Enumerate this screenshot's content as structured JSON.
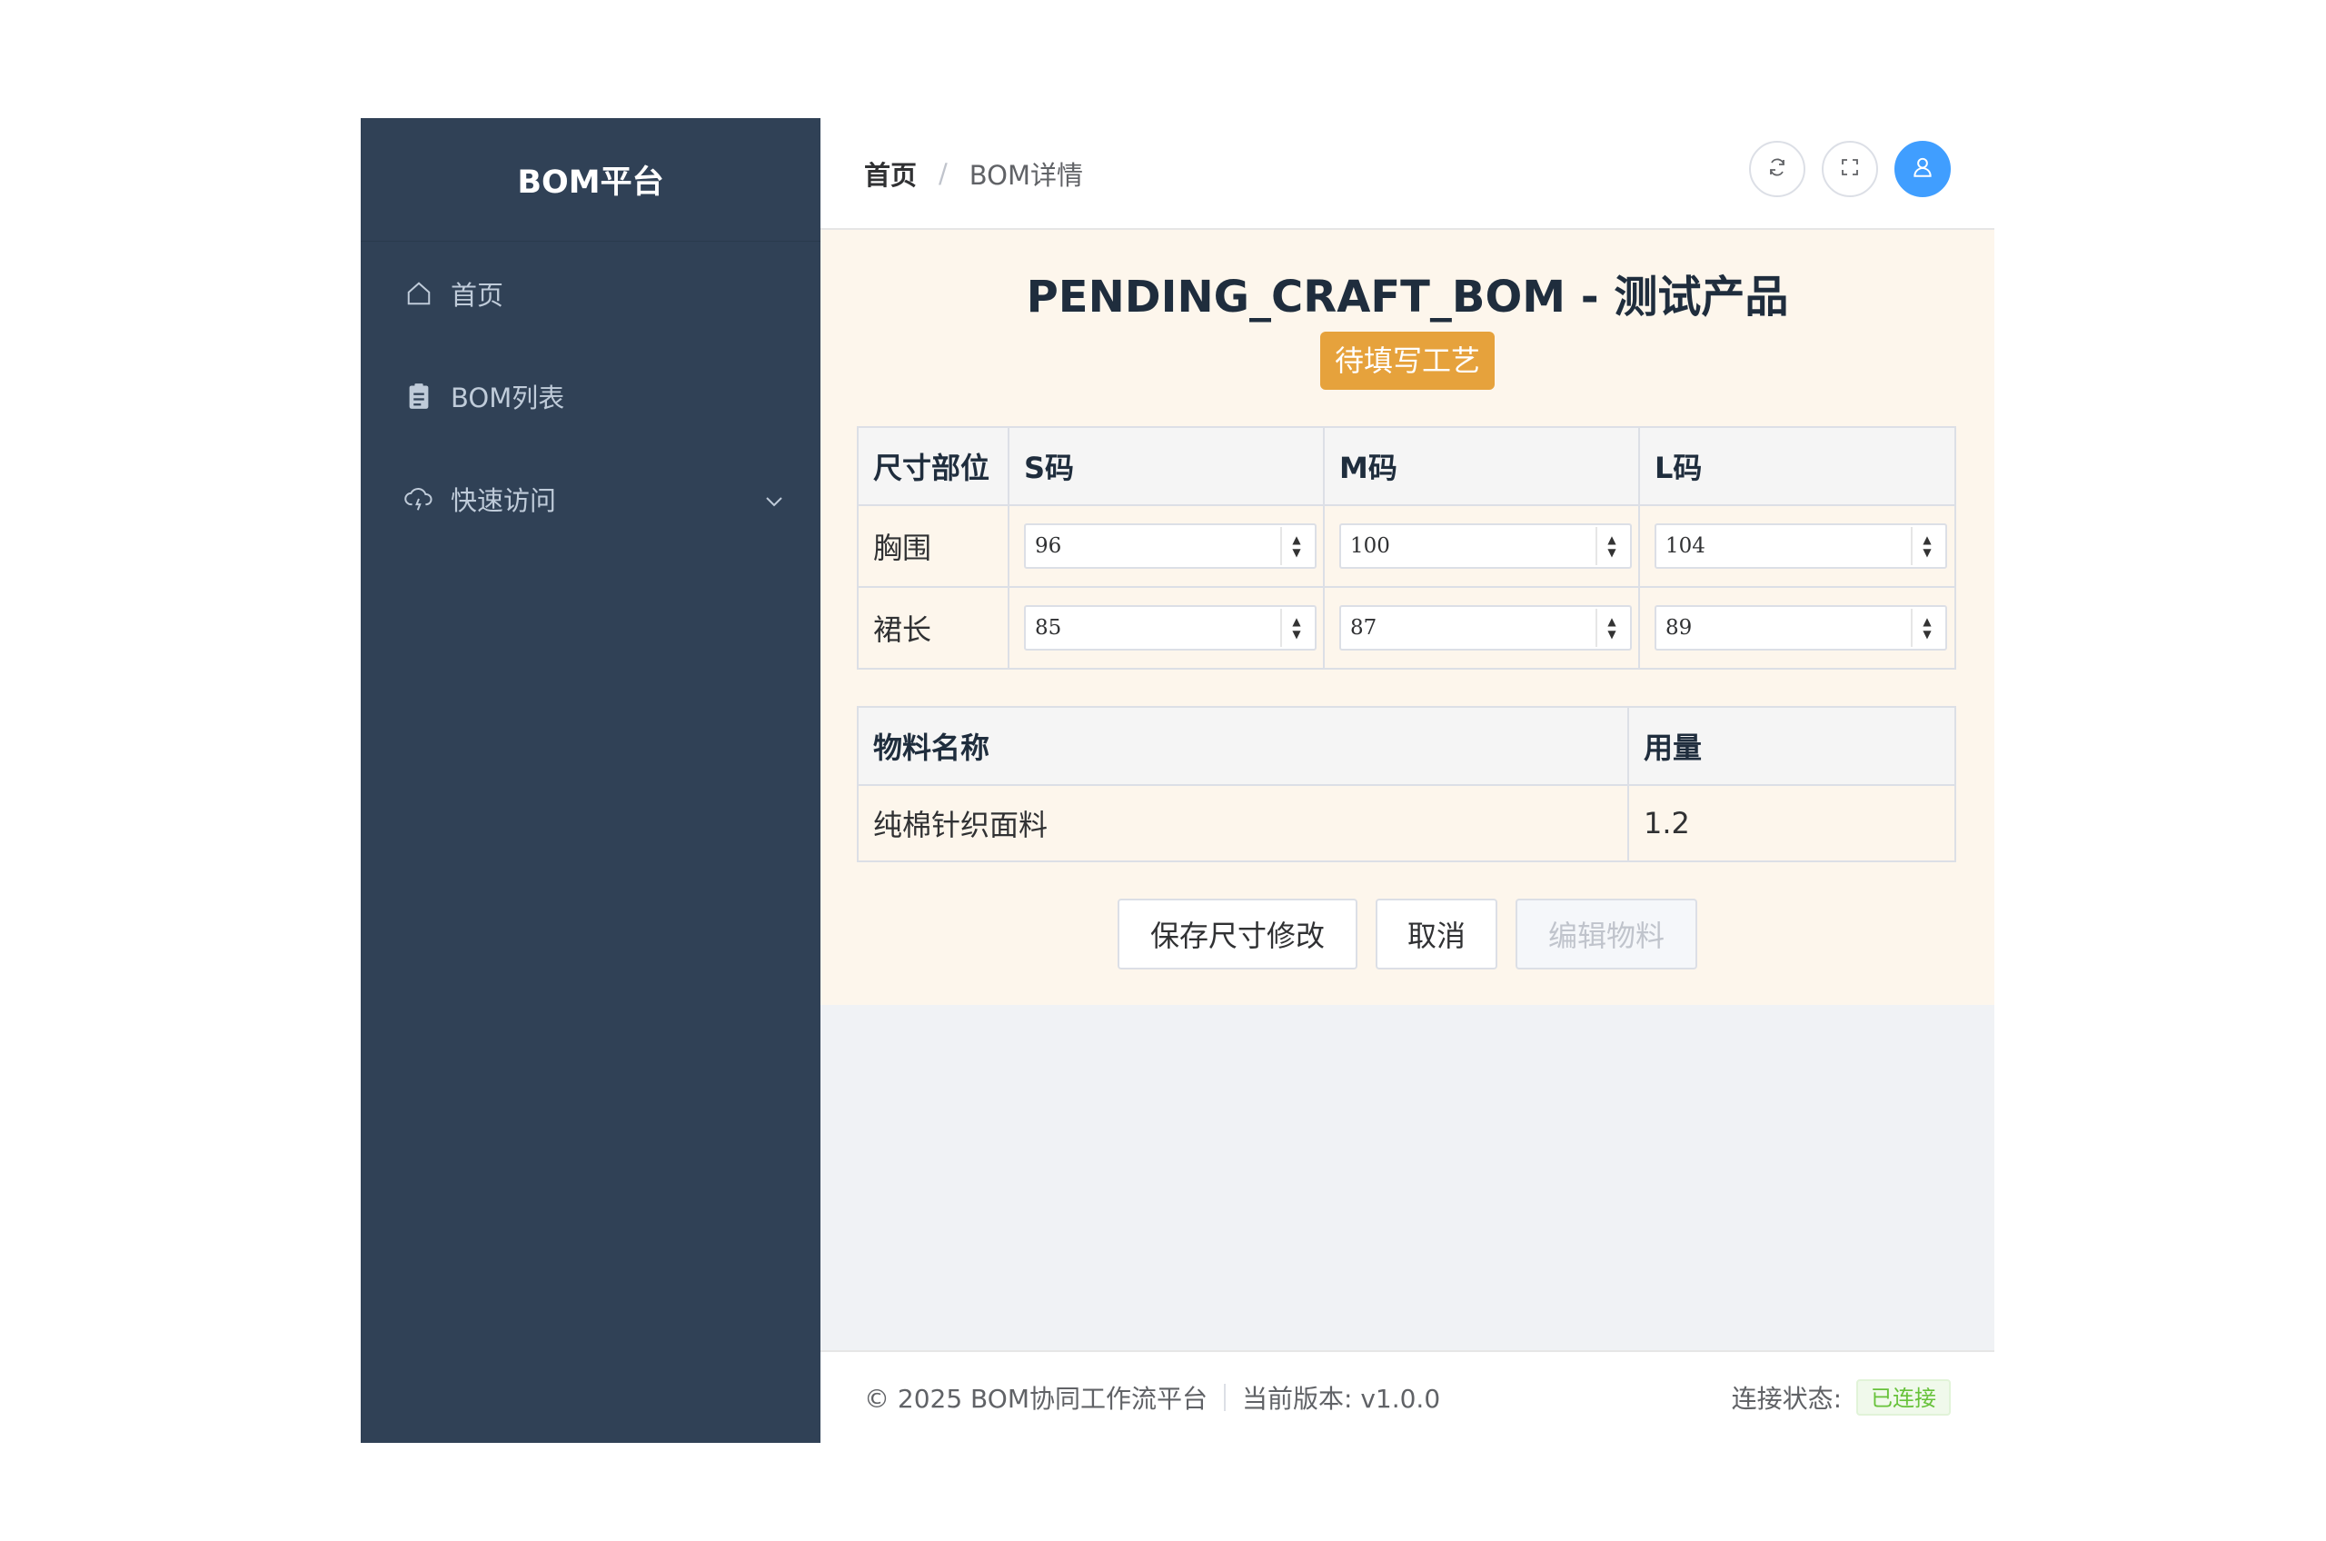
{
  "sidebar": {
    "logo": "BOM平台",
    "items": [
      {
        "label": "首页",
        "icon": "home-icon"
      },
      {
        "label": "BOM列表",
        "icon": "clipboard-icon"
      },
      {
        "label": "快速访问",
        "icon": "cloud-icon"
      }
    ]
  },
  "header": {
    "breadcrumb": [
      "首页",
      "BOM详情"
    ],
    "separator": "/"
  },
  "main": {
    "title": "PENDING_CRAFT_BOM - 测试产品",
    "status_tag": "待填写工艺",
    "size_table": {
      "headers": [
        "尺寸部位",
        "S码",
        "M码",
        "L码"
      ],
      "rows": [
        {
          "part": "胸围",
          "values": [
            "96",
            "100",
            "104"
          ]
        },
        {
          "part": "裙长",
          "values": [
            "85",
            "87",
            "89"
          ]
        }
      ]
    },
    "material_table": {
      "headers": [
        "物料名称",
        "用量"
      ],
      "rows": [
        {
          "name": "纯棉针织面料",
          "amount": "1.2"
        }
      ]
    },
    "buttons": {
      "save": "保存尺寸修改",
      "cancel": "取消",
      "edit_material": "编辑物料"
    }
  },
  "footer": {
    "copyright": "© 2025 BOM协同工作流平台",
    "version": "当前版本: v1.0.0",
    "connection_label": "连接状态:",
    "connection_status": "已连接"
  },
  "colors": {
    "sidebar_bg": "#304156",
    "content_bg": "#fdf6ec",
    "tag_bg": "#e6a23c",
    "avatar_bg": "#409eff",
    "status_green": "#67c23a"
  }
}
